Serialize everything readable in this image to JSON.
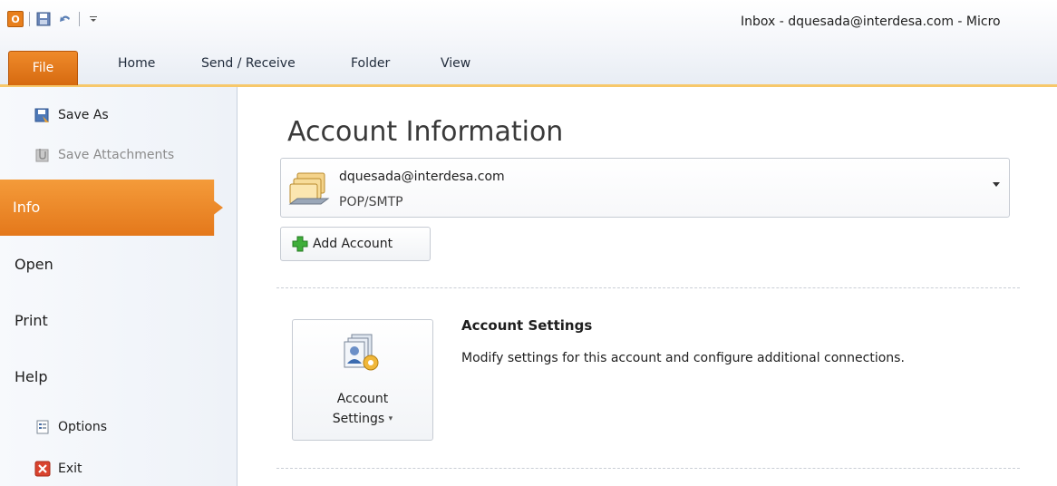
{
  "window": {
    "title": "Inbox - dquesada@interdesa.com - Micro"
  },
  "quick_access": {
    "app_icon": "outlook-icon",
    "items": [
      "save-icon",
      "undo-icon",
      "customize-icon"
    ]
  },
  "ribbon": {
    "file_tab": "File",
    "tabs": [
      "Home",
      "Send / Receive",
      "Folder",
      "View"
    ]
  },
  "backstage_nav": {
    "commands": [
      {
        "label": "Save As",
        "icon": "save-as-icon",
        "enabled": true
      },
      {
        "label": "Save Attachments",
        "icon": "save-attachments-icon",
        "enabled": false
      }
    ],
    "selected": "Info",
    "items": [
      "Open",
      "Print",
      "Help"
    ],
    "bottom_commands": [
      {
        "label": "Options",
        "icon": "options-icon"
      },
      {
        "label": "Exit",
        "icon": "exit-icon"
      }
    ]
  },
  "main": {
    "title": "Account Information",
    "account": {
      "email": "dquesada@interdesa.com",
      "type": "POP/SMTP"
    },
    "add_account_label": "Add Account",
    "account_settings": {
      "button_line1": "Account",
      "button_line2": "Settings",
      "heading": "Account Settings",
      "description": "Modify settings for this account and configure additional connections."
    }
  },
  "colors": {
    "file_tab": "#e4781b",
    "selected_nav": "#f49b3a",
    "ribbon_accent": "#f7c86a"
  }
}
